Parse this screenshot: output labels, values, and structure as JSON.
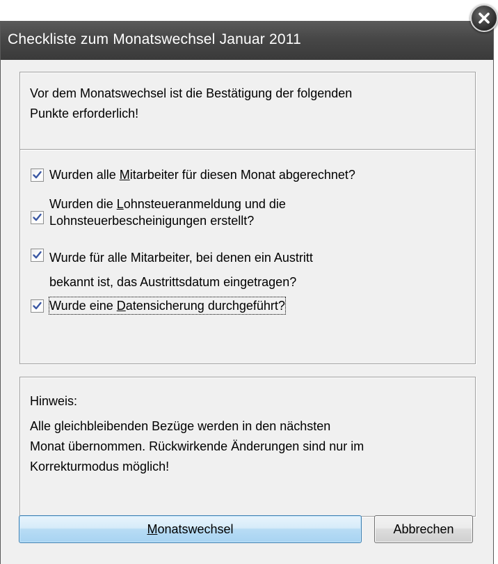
{
  "window": {
    "title": "Checkliste zum Monatswechsel Januar 2011"
  },
  "intro": {
    "line1": "Vor dem Monatswechsel ist die Bestätigung der folgenden",
    "line2": "Punkte erforderlich!"
  },
  "checklist": {
    "items": [
      {
        "line1_pre": "Wurden alle ",
        "line1_mn": "M",
        "line1_post": "itarbeiter für diesen Monat abgerechnet?",
        "checked": true
      },
      {
        "line1_pre": "Wurden die ",
        "line1_mn": "L",
        "line1_post": "ohnsteueranmeldung und die",
        "line2": "Lohnsteuerbescheinigungen erstellt?",
        "checked": true
      },
      {
        "line1": "Wurde für alle Mitarbeiter, bei denen ein Austritt",
        "line2": "bekannt ist, das Austrittsdatum eingetragen?",
        "checked": true
      },
      {
        "line1_pre": "Wurde eine ",
        "line1_mn": "D",
        "line1_post": "atensicherung durchgeführt?",
        "checked": true
      }
    ]
  },
  "hint": {
    "heading": "Hinweis:",
    "line1": "Alle gleichbleibenden Bezüge werden in den nächsten",
    "line2": "Monat übernommen. Rückwirkende Änderungen sind nur im",
    "line3": "Korrekturmodus möglich!"
  },
  "buttons": {
    "confirm_mn": "M",
    "confirm_rest": "onatswechsel",
    "cancel": "Abbrechen"
  },
  "icons": {
    "close": "close-icon",
    "checkmark": "checkmark-icon"
  },
  "colors": {
    "titlebar": "#474747",
    "check": "#3a57a3",
    "primary_border": "#3c7fb1"
  }
}
